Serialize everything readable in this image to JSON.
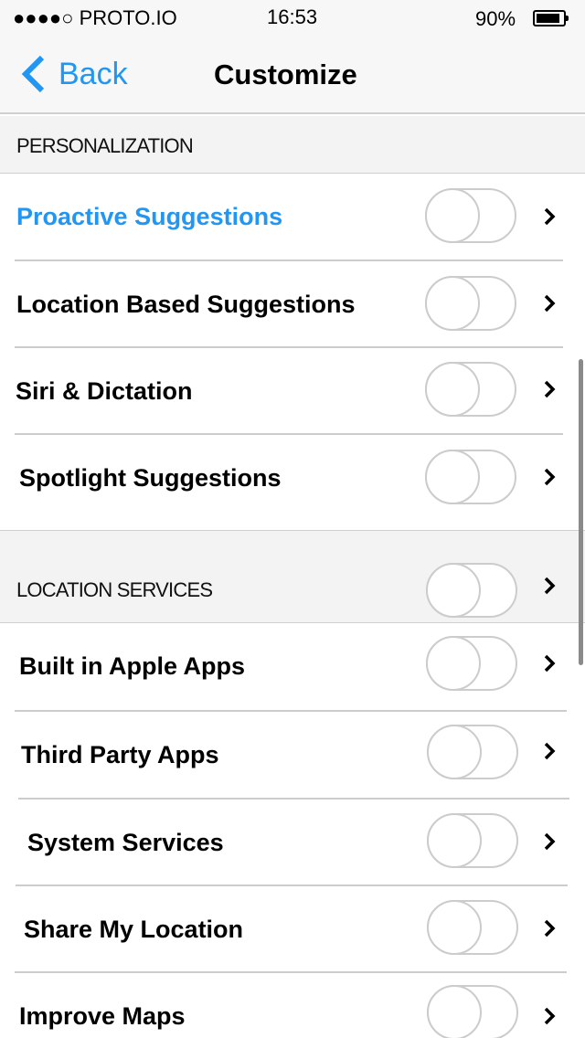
{
  "status_bar": {
    "signal": "●●●●○",
    "carrier": "PROTO.IO",
    "time": "16:53",
    "battery_percent": "90%",
    "battery_level": 0.9
  },
  "nav": {
    "back_label": "Back",
    "back_icon": "chevron-left-icon",
    "title": "Customize"
  },
  "sections": [
    {
      "header": "PERSONALIZATION",
      "items": [
        {
          "label": "Proactive Suggestions",
          "toggle_on": false,
          "highlighted": true
        },
        {
          "label": "Location Based Suggestions",
          "toggle_on": false
        },
        {
          "label": "Siri & Dictation",
          "toggle_on": false
        },
        {
          "label": "Spotlight Suggestions",
          "toggle_on": false
        }
      ]
    },
    {
      "header": "LOCATION SERVICES",
      "header_toggle_on": false,
      "items": [
        {
          "label": "Built in Apple Apps",
          "toggle_on": false
        },
        {
          "label": "Third Party Apps",
          "toggle_on": false
        },
        {
          "label": "System Services",
          "toggle_on": false
        },
        {
          "label": "Share My Location",
          "toggle_on": false
        },
        {
          "label": "Improve Maps",
          "toggle_on": false
        }
      ]
    }
  ],
  "colors": {
    "accent": "#2196f3",
    "toggle_border": "#cccccc",
    "section_bg": "#f3f3f3",
    "nav_bg": "#f7f7f7"
  }
}
